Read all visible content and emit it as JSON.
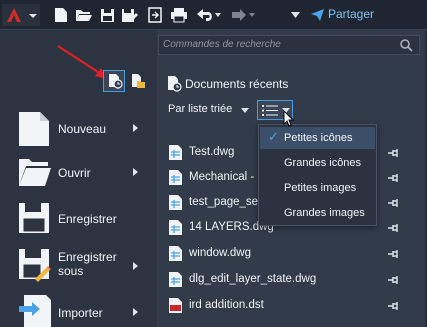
{
  "toolbar": {
    "share_label": "Partager",
    "icons": [
      "autocad-app-icon",
      "new-icon",
      "open-icon",
      "save-icon",
      "save-as-icon",
      "publish-icon",
      "print-icon",
      "undo-icon",
      "redo-icon",
      "customize-icon",
      "share-icon"
    ]
  },
  "search": {
    "placeholder": "Commandes de recherche"
  },
  "left_menu": [
    {
      "label": "Nouveau",
      "has_submenu": true
    },
    {
      "label": "Ouvrir",
      "has_submenu": true
    },
    {
      "label": "Enregistrer",
      "has_submenu": false
    },
    {
      "label": "Enregistrer\nsous",
      "has_submenu": true
    },
    {
      "label": "Importer",
      "has_submenu": true
    }
  ],
  "recent": {
    "title": "Documents récents",
    "sort_label": "Par liste triée",
    "files": [
      {
        "name": "Test.dwg",
        "type": "dwg"
      },
      {
        "name": "Mechanical -",
        "type": "dwg"
      },
      {
        "name": "test_page_set",
        "type": "dwg"
      },
      {
        "name": "14 LAYERS.dwg",
        "type": "dwg"
      },
      {
        "name": "window.dwg",
        "type": "dwg"
      },
      {
        "name": "dlg_edit_layer_state.dwg",
        "type": "dwg"
      },
      {
        "name": "ird addition.dst",
        "type": "dst"
      }
    ]
  },
  "view_dropdown": {
    "options": [
      {
        "label": "Petites icônes",
        "checked": true
      },
      {
        "label": "Grandes icônes",
        "checked": false
      },
      {
        "label": "Petites images",
        "checked": false
      },
      {
        "label": "Grandes images",
        "checked": false
      }
    ]
  },
  "colors": {
    "accent": "#4aa3e8",
    "annotation_arrow": "#e02020",
    "app_red": "#d42a2a"
  }
}
